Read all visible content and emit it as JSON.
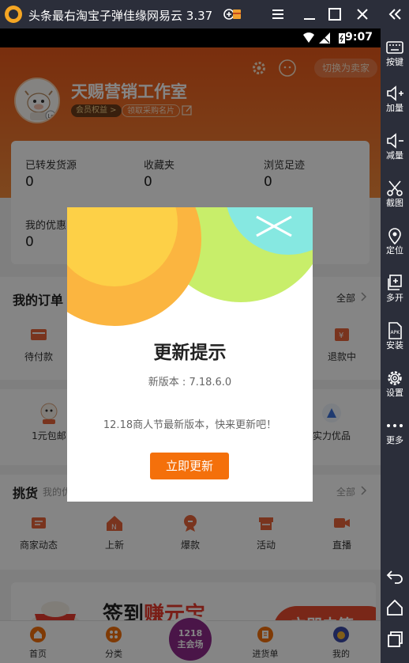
{
  "emulator": {
    "window_title": "头条最右淘宝子弹佳缘网易云 3.37",
    "toolbar": [
      {
        "label": "按键",
        "icon": "keyboard-icon"
      },
      {
        "label": "加量",
        "icon": "volume-up-icon"
      },
      {
        "label": "减量",
        "icon": "volume-down-icon"
      },
      {
        "label": "截图",
        "icon": "scissors-icon"
      },
      {
        "label": "定位",
        "icon": "location-pin-icon"
      },
      {
        "label": "多开",
        "icon": "multi-window-icon"
      },
      {
        "label": "安装",
        "icon": "apk-install-icon"
      },
      {
        "label": "设置",
        "icon": "settings-gear-icon"
      },
      {
        "label": "更多",
        "icon": "more-dots-icon"
      }
    ]
  },
  "statusbar": {
    "time": "9:07"
  },
  "profile": {
    "switch_label": "切换为卖家",
    "shop_name": "天赐营销工作室",
    "member_chip": "会员权益 >",
    "card_chip": "领取采购名片"
  },
  "stats": {
    "forwarded_label": "已转发货源",
    "forwarded_value": "0",
    "favorites_label": "收藏夹",
    "favorites_value": "0",
    "history_label": "浏览足迹",
    "history_value": "0",
    "coupons_label": "我的优惠",
    "coupons_value": "0"
  },
  "orders": {
    "title": "我的订单",
    "all_label": "全部",
    "items": [
      "待付款",
      "退款中"
    ]
  },
  "deals": {
    "items": [
      "1元包邮",
      "实力优品"
    ]
  },
  "picks": {
    "title": "挑货",
    "subtitle": "我的优",
    "all_label": "全部",
    "items": [
      "商家动态",
      "上新",
      "爆款",
      "活动",
      "直播"
    ]
  },
  "promo": {
    "title_prefix": "签到",
    "title_highlight": "赚元宝",
    "button_label": "立即去签"
  },
  "tabbar": {
    "items": [
      "首页",
      "分类",
      "进货单",
      "我的"
    ],
    "center_line1": "1218",
    "center_line2": "主会场"
  },
  "dialog": {
    "title": "更新提示",
    "version": "新版本 : 7.18.6.0",
    "message": "12.18商人节最新版本，快来更新吧！",
    "button_label": "立即更新"
  },
  "colors": {
    "accent": "#f4700b",
    "header": "#e9591a",
    "emulator_chrome": "#2b2e3a"
  }
}
